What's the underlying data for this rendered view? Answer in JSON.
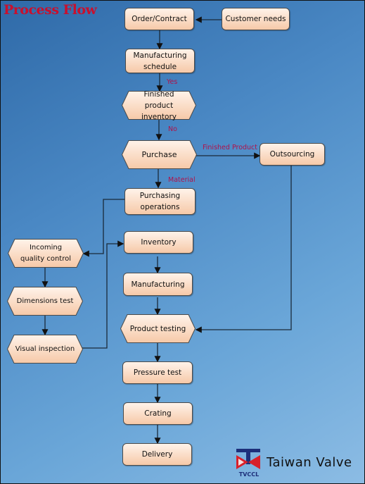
{
  "title": "Process Flow",
  "nodes": {
    "order_contract": "Order/Contract",
    "customer_needs": "Customer needs",
    "manufacturing_schedule": "Manufacturing schedule",
    "finished_product_inventory": "Finished product inventory",
    "purchase": "Purchase",
    "outsourcing": "Outsourcing",
    "purchasing_operations": "Purchasing operations",
    "incoming_quality_control": "Incoming quality control",
    "dimensions_test": "Dimensions test",
    "visual_inspection": "Visual inspection",
    "inventory": "Inventory",
    "manufacturing": "Manufacturing",
    "product_testing": "Product testing",
    "pressure_test": "Pressure test",
    "crating": "Crating",
    "delivery": "Delivery"
  },
  "edge_labels": {
    "yes": "Yes",
    "no": "No",
    "finished_product": "Finished Product",
    "material": "Material"
  },
  "brand": {
    "logo_text": "TVCCL",
    "name": "Taiwan Valve"
  },
  "colors": {
    "title": "#c8102e",
    "edge_label": "#b0124a",
    "node_fill_top": "#fff3ea",
    "node_fill_bottom": "#f6c9a8"
  }
}
